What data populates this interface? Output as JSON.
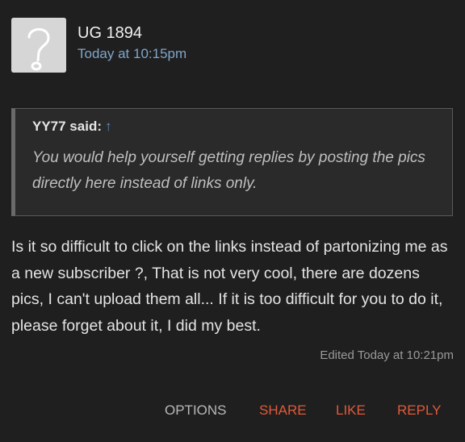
{
  "post": {
    "author": "UG 1894",
    "time": "Today at 10:15pm",
    "quote": {
      "attribution": "YY77 said:",
      "jump_icon": "up-arrow-icon",
      "jump_glyph": "↑",
      "text": "You would help yourself getting replies by posting the pics directly here instead of links only."
    },
    "message": "Is it so difficult to click on the links instead of partonizing me as a new subscriber ?, That is not very cool, there are dozens pics, I can't upload them all... If it is too difficult for you to do it, please forget about it, I did my best.",
    "edited": "Edited Today at 10:21pm"
  },
  "actions": {
    "options": "OPTIONS",
    "share": "SHARE",
    "like": "LIKE",
    "reply": "REPLY"
  },
  "colors": {
    "background": "#1f1f1f",
    "accent": "#e05a3a",
    "timestamp": "#7fa6c9"
  },
  "icons": {
    "avatar": "question-mark-avatar-icon"
  }
}
